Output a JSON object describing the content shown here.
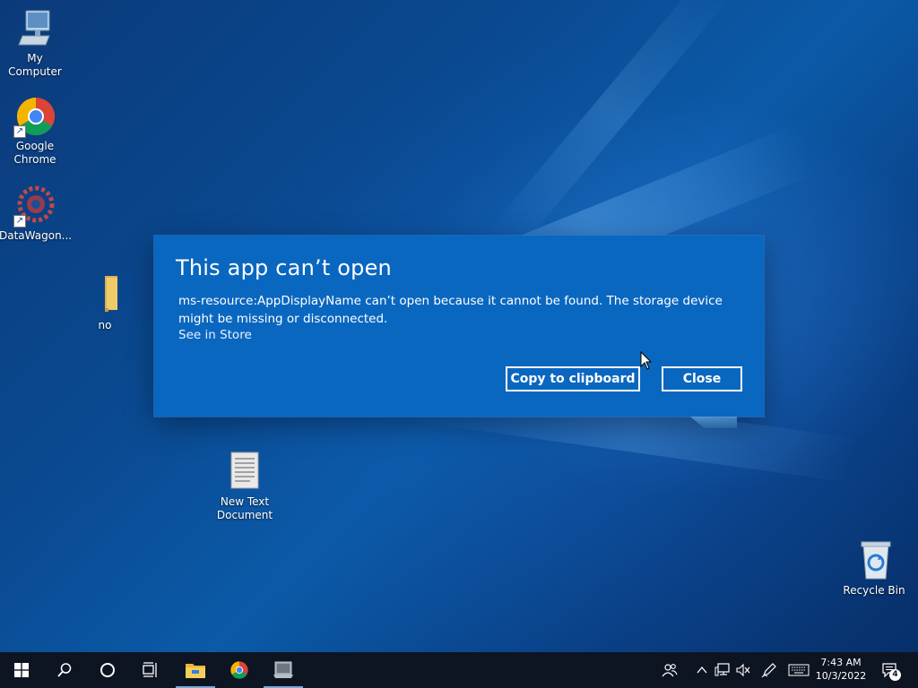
{
  "desktop": {
    "icons": [
      {
        "label": "My Computer",
        "icon": "computer-icon"
      },
      {
        "label": "Google Chrome",
        "icon": "chrome-icon"
      },
      {
        "label": "DataWagon...",
        "icon": "datawagon-icon"
      },
      {
        "label": "no",
        "icon": "folder-icon"
      },
      {
        "label": "New Text Document",
        "icon": "text-document-icon"
      },
      {
        "label": "Recycle Bin",
        "icon": "recycle-bin-icon"
      }
    ]
  },
  "dialog": {
    "title": "This app can’t open",
    "message": "ms-resource:AppDisplayName can’t open because it cannot be found. The storage device might be missing or disconnected.",
    "link": "See in Store",
    "copy_label": "Copy to clipboard",
    "close_label": "Close",
    "background_color": "#0a67c0"
  },
  "taskbar": {
    "items": [
      "start-icon",
      "search-icon",
      "cortana-icon",
      "task-view-icon",
      "file-explorer-icon",
      "chrome-icon",
      "app-window-icon"
    ],
    "tray": [
      "people-icon",
      "chevron-up-icon",
      "network-icon",
      "volume-muted-icon",
      "pen-icon",
      "keyboard-icon"
    ],
    "time": "7:43 AM",
    "date": "10/3/2022",
    "notification_count": "4",
    "background_color": "#0d1522"
  }
}
